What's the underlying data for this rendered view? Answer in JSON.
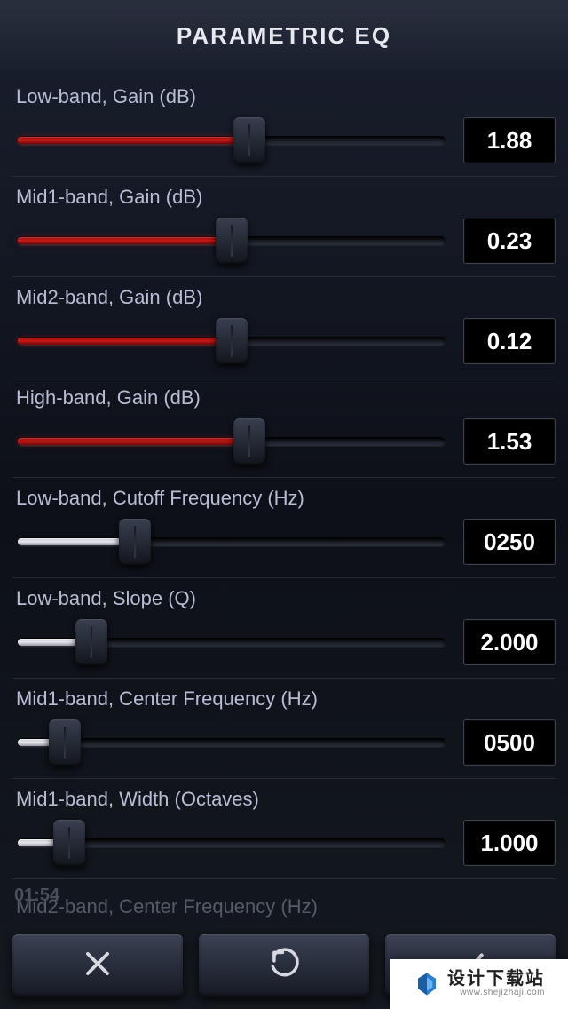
{
  "header": {
    "title": "PARAMETRIC EQ"
  },
  "params": [
    {
      "label": "Low-band, Gain (dB)",
      "value": "1.88",
      "fill_pct": 54,
      "color": "red"
    },
    {
      "label": "Mid1-band, Gain (dB)",
      "value": "0.23",
      "fill_pct": 50,
      "color": "red"
    },
    {
      "label": "Mid2-band, Gain (dB)",
      "value": "0.12",
      "fill_pct": 50,
      "color": "red"
    },
    {
      "label": "High-band, Gain (dB)",
      "value": "1.53",
      "fill_pct": 54,
      "color": "red"
    },
    {
      "label": "Low-band, Cutoff Frequency (Hz)",
      "value": "0250",
      "fill_pct": 28,
      "color": "gray"
    },
    {
      "label": "Low-band, Slope (Q)",
      "value": "2.000",
      "fill_pct": 18,
      "color": "gray"
    },
    {
      "label": "Mid1-band, Center Frequency (Hz)",
      "value": "0500",
      "fill_pct": 12,
      "color": "gray"
    },
    {
      "label": "Mid1-band, Width (Octaves)",
      "value": "1.000",
      "fill_pct": 13,
      "color": "gray"
    }
  ],
  "clipped_label": "Mid2-band, Center Frequency (Hz)",
  "bg_time": "01:54",
  "toolbar": {
    "cancel_icon": "close-icon",
    "undo_icon": "undo-icon",
    "confirm_icon": "check-icon"
  },
  "watermark": {
    "cn": "设计下载站",
    "en": "www.shejizhaji.com"
  }
}
